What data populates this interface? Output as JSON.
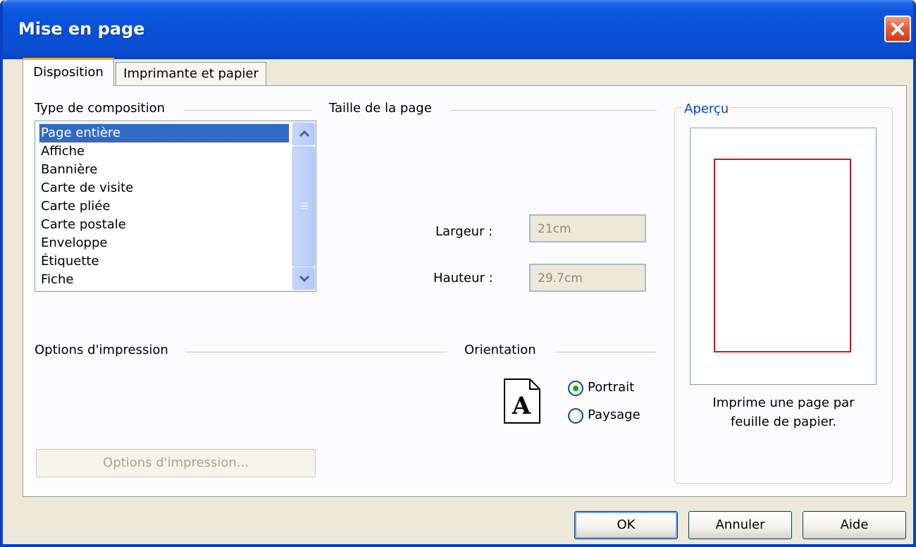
{
  "window": {
    "title": "Mise en page"
  },
  "tabs": [
    {
      "label": "Disposition",
      "active": true
    },
    {
      "label": "Imprimante et papier",
      "active": false
    }
  ],
  "composition": {
    "heading": "Type de composition",
    "items": [
      "Page entière",
      "Affiche",
      "Bannière",
      "Carte de visite",
      "Carte pliée",
      "Carte postale",
      "Enveloppe",
      "Étiquette",
      "Fiche"
    ],
    "selected": "Page entière"
  },
  "page_size": {
    "heading": "Taille de la page",
    "width_label": "Largeur :",
    "width_value": "21cm",
    "height_label": "Hauteur :",
    "height_value": "29.7cm"
  },
  "print_options": {
    "heading": "Options d'impression",
    "button_label": "Options d'impression..."
  },
  "orientation": {
    "heading": "Orientation",
    "icon_letter": "A",
    "portrait_label": "Portrait",
    "landscape_label": "Paysage",
    "selected": "Portrait"
  },
  "preview": {
    "heading": "Aperçu",
    "caption_line1": "Imprime une page par",
    "caption_line2": "feuille de papier."
  },
  "buttons": {
    "ok": "OK",
    "cancel": "Annuler",
    "help": "Aide"
  },
  "colors": {
    "titlebar": "#0a56de",
    "selection": "#316ac5",
    "preview_margin": "#e01010",
    "accent_tab": "#f7a82a"
  }
}
